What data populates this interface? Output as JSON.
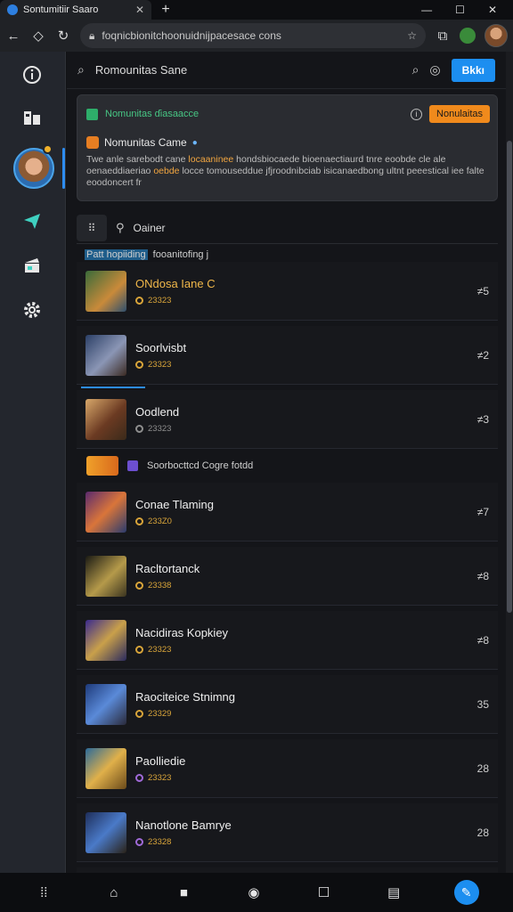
{
  "browser": {
    "tab_title": "Sontumitiir Saaro",
    "url": "foqnicbionitchoonuidnijpacesace cons",
    "window_controls": [
      "—",
      "☐",
      "✕"
    ]
  },
  "sidebar": {
    "icons": [
      "info-icon",
      "library-icon",
      "send-icon",
      "store-icon",
      "settings-icon"
    ]
  },
  "header": {
    "search_title": "Romounitas Sane",
    "primary_button": "Bkkı"
  },
  "notice": {
    "title": "Nomunitas ɗiasaacce",
    "action_button": "Nonulaitas",
    "subtitle": "Nomunitas Came",
    "body_pre": "Twe anle sarebodt cane",
    "body_hl1": "locaaninee",
    "body_mid1": "hondsbiocaede bioenaectiaurd tnre eoobde cle ale oenaeddiaeriao",
    "body_hl2": "oebde",
    "body_mid2": "locce tomouseddue jfjroodnibciab isicanaedbong ultnt peeestical iee falte",
    "body_end": "eoodoncert fr"
  },
  "filter": {
    "label": "Oainer"
  },
  "section1": {
    "label": "Patt hopiiding",
    "sub": "fooanitofing j"
  },
  "section2": {
    "label": "Soorbocttcd Cogre fotdd"
  },
  "games": [
    {
      "name": "ONdosa Iane C",
      "sub": "23323",
      "count": "≠5"
    },
    {
      "name": "Soorlvisbt",
      "sub": "23323",
      "count": "≠2"
    },
    {
      "name": "Oodlend",
      "sub": "23323",
      "count": "≠3"
    },
    {
      "name": "Conae Tlaming",
      "sub": "233Z0",
      "count": "≠7"
    },
    {
      "name": "Racltortanck",
      "sub": "23338",
      "count": "≠8"
    },
    {
      "name": "Nacidiras Kopkiey",
      "sub": "23323",
      "count": "≠8"
    },
    {
      "name": "Raociteice Stnimng",
      "sub": "23329",
      "count": "35"
    },
    {
      "name": "Paolliedie",
      "sub": "23323",
      "count": "28"
    },
    {
      "name": "Nanotlone Bamrye",
      "sub": "23328",
      "count": "28"
    }
  ],
  "colors": {
    "accent_blue": "#1c8ef0",
    "accent_orange": "#f08a1c",
    "accent_green": "#47c684",
    "gold": "#f0b74a"
  }
}
